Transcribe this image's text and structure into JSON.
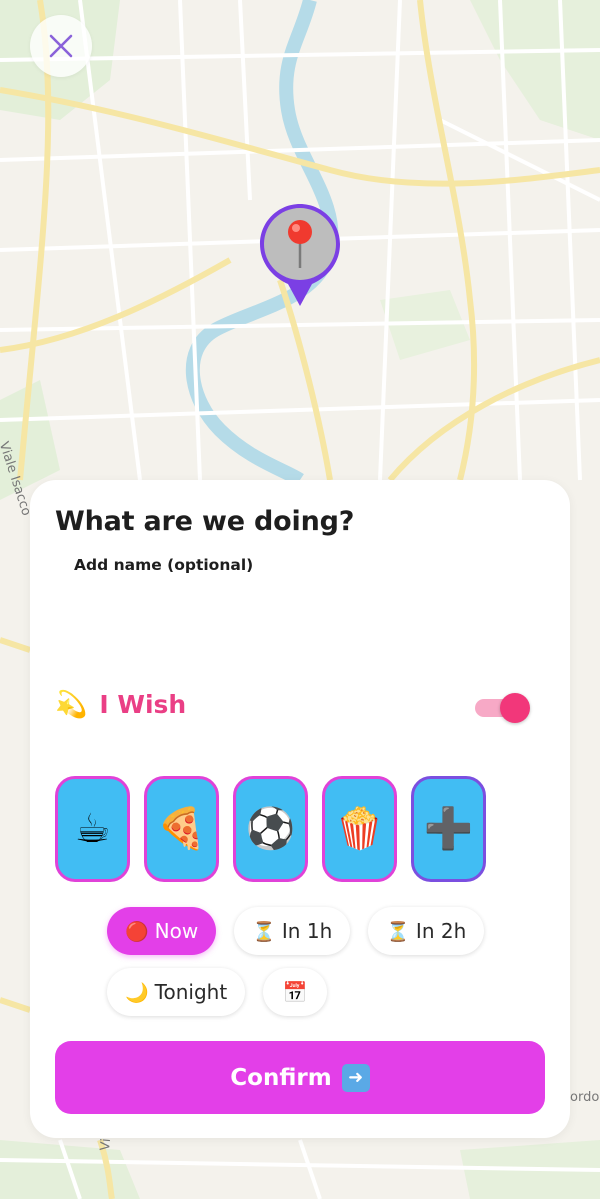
{
  "map": {
    "street_labels": [
      "Viale Isacco",
      "Via",
      "ordo"
    ]
  },
  "close_button": {
    "icon": "close-icon",
    "color": "#8a62d9"
  },
  "pin": {
    "icon": "round-pushpin-icon",
    "border_color": "#7b3fe4"
  },
  "sheet": {
    "title": "What are we doing?",
    "name_label": "Add name (optional)",
    "name_value": "",
    "wish": {
      "icon": "dizzy-star-icon",
      "label": "I Wish",
      "enabled": true,
      "color": "#ea3f85"
    },
    "activities": [
      {
        "name": "coffee",
        "emoji": "☕"
      },
      {
        "name": "pizza",
        "emoji": "🍕"
      },
      {
        "name": "soccer-ball",
        "emoji": "⚽"
      },
      {
        "name": "popcorn",
        "emoji": "🍿"
      },
      {
        "name": "add",
        "emoji": "➕"
      }
    ],
    "times_row1": [
      {
        "icon": "🔴",
        "label": "Now",
        "active": true
      },
      {
        "icon": "⏳",
        "label": "In 1h",
        "active": false
      },
      {
        "icon": "⏳",
        "label": "In 2h",
        "active": false
      }
    ],
    "times_row2": [
      {
        "icon": "🌙",
        "label": "Tonight",
        "active": false
      },
      {
        "icon": "📅",
        "label": "",
        "active": false
      }
    ],
    "confirm_label": "Confirm",
    "confirm_icon": "➡️",
    "accent_color": "#e33fe8",
    "tile_color": "#41bdf3"
  }
}
